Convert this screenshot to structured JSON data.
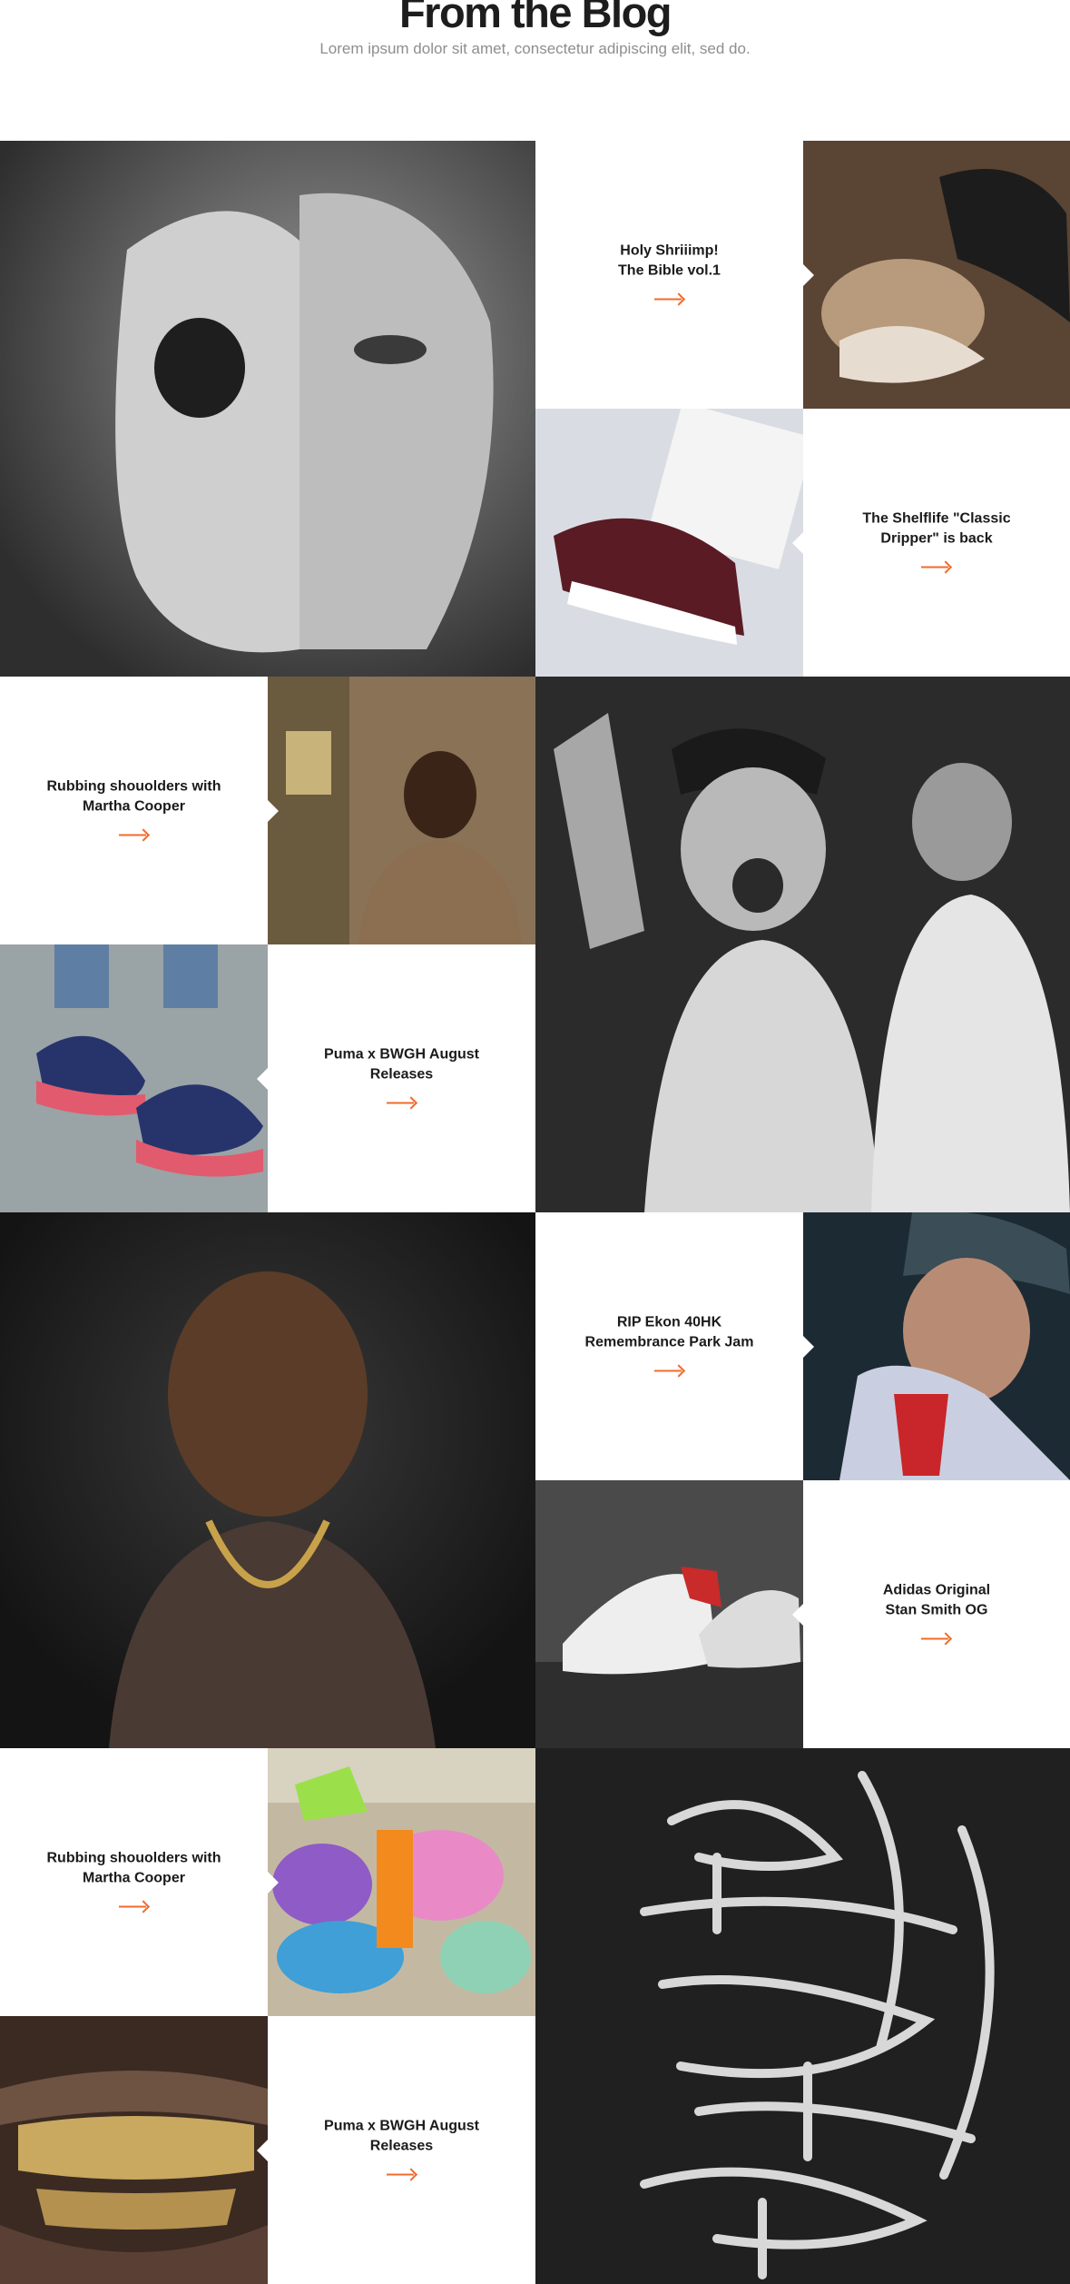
{
  "header": {
    "title": "From the Blog",
    "subtitle": "Lorem ipsum dolor sit amet, consectetur adipiscing elit, sed do."
  },
  "accent_color": "#f26b2a",
  "posts": [
    {
      "line1": "Holy Shriiimp!",
      "line2": "The Bible vol.1"
    },
    {
      "line1": "The Shelflife \"Classic",
      "line2": "Dripper\" is back"
    },
    {
      "line1": "Rubbing shouolders with",
      "line2": "Martha Cooper"
    },
    {
      "line1": "Puma x BWGH August",
      "line2": "Releases"
    },
    {
      "line1": "RIP Ekon 40HK",
      "line2": "Remembrance Park Jam"
    },
    {
      "line1": "Adidas Original",
      "line2": "Stan Smith OG"
    },
    {
      "line1": "Rubbing shouolders with",
      "line2": "Martha Cooper"
    },
    {
      "line1": "Puma x BWGH August",
      "line2": "Releases"
    }
  ],
  "images": [
    {
      "name": "skull-face-photo"
    },
    {
      "name": "girl-with-cap-photo"
    },
    {
      "name": "sneaker-box-photo"
    },
    {
      "name": "subway-woman-photo"
    },
    {
      "name": "puma-sneakers-photo"
    },
    {
      "name": "party-crowd-photo"
    },
    {
      "name": "portrait-man-photo"
    },
    {
      "name": "girl-drinking-photo"
    },
    {
      "name": "white-sneakers-photo"
    },
    {
      "name": "graffiti-wall-photo"
    },
    {
      "name": "gold-teeth-photo"
    },
    {
      "name": "calligraphy-art-photo"
    }
  ]
}
